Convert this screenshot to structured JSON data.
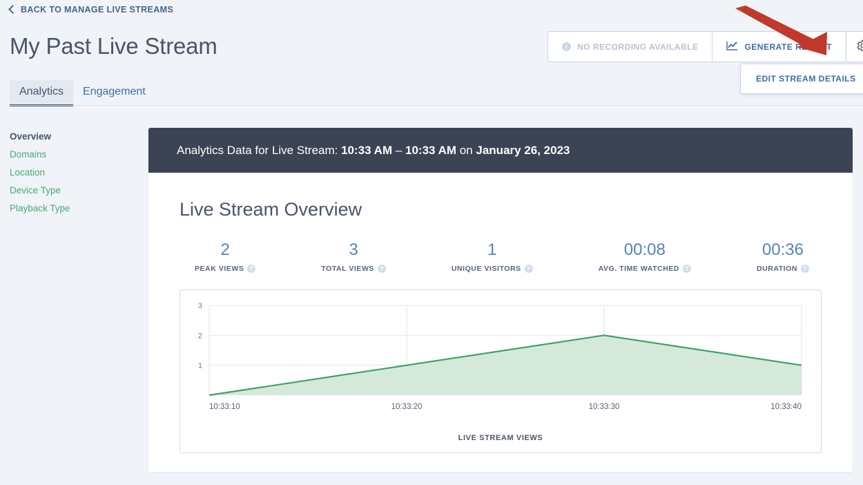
{
  "back_link": {
    "label": "BACK TO MANAGE LIVE STREAMS",
    "icon": "chevron-left-icon"
  },
  "page_title": "My Past Live Stream",
  "header_actions": {
    "recording_status": {
      "label": "NO RECORDING AVAILABLE",
      "icon": "info-icon",
      "enabled": false
    },
    "generate_report": {
      "label": "GENERATE REPORT",
      "icon": "line-chart-icon"
    },
    "settings": {
      "icon": "gear-icon"
    }
  },
  "dropdown": {
    "items": [
      {
        "label": "EDIT STREAM DETAILS"
      }
    ]
  },
  "tabs": [
    {
      "label": "Analytics",
      "active": true
    },
    {
      "label": "Engagement",
      "active": false
    }
  ],
  "sidebar": {
    "items": [
      {
        "label": "Overview",
        "active": true
      },
      {
        "label": "Domains",
        "active": false
      },
      {
        "label": "Location",
        "active": false
      },
      {
        "label": "Device Type",
        "active": false
      },
      {
        "label": "Playback Type",
        "active": false
      }
    ]
  },
  "card_header": {
    "prefix": "Analytics Data for Live Stream: ",
    "start_time": "10:33 AM",
    "separator": " – ",
    "end_time": "10:33 AM",
    "on_word": " on ",
    "date": "January 26, 2023"
  },
  "section_title": "Live Stream Overview",
  "stats": [
    {
      "value": "2",
      "label": "PEAK VIEWS",
      "help": "?"
    },
    {
      "value": "3",
      "label": "TOTAL VIEWS",
      "help": "?"
    },
    {
      "value": "1",
      "label": "UNIQUE VISITORS",
      "help": "?"
    },
    {
      "value": "00:08",
      "label": "AVG. TIME WATCHED",
      "help": "?"
    },
    {
      "value": "00:36",
      "label": "DURATION",
      "help": "?"
    }
  ],
  "chart_caption": "LIVE STREAM VIEWS",
  "colors": {
    "accent_blue": "#3c6ca8",
    "link_green": "#4aa777",
    "header_dark": "#3b4354",
    "chart_line": "#3fa164",
    "chart_fill": "#d5e9da",
    "annotation_red": "#c0392b",
    "page_bg": "#f0f3f8"
  },
  "chart_data": {
    "type": "area",
    "title": "",
    "xlabel": "LIVE STREAM VIEWS",
    "ylabel": "",
    "x": [
      "10:33:10",
      "10:33:20",
      "10:33:30",
      "10:33:40"
    ],
    "values": [
      0,
      1,
      2,
      1
    ],
    "series": [
      {
        "name": "Live Stream Views",
        "values": [
          0,
          1,
          2,
          1
        ]
      }
    ],
    "yticks": [
      1,
      2,
      3
    ],
    "ylim": [
      0,
      3
    ],
    "grid": true,
    "legend": "none",
    "line_color": "#3fa164",
    "fill_color": "#d5e9da"
  }
}
